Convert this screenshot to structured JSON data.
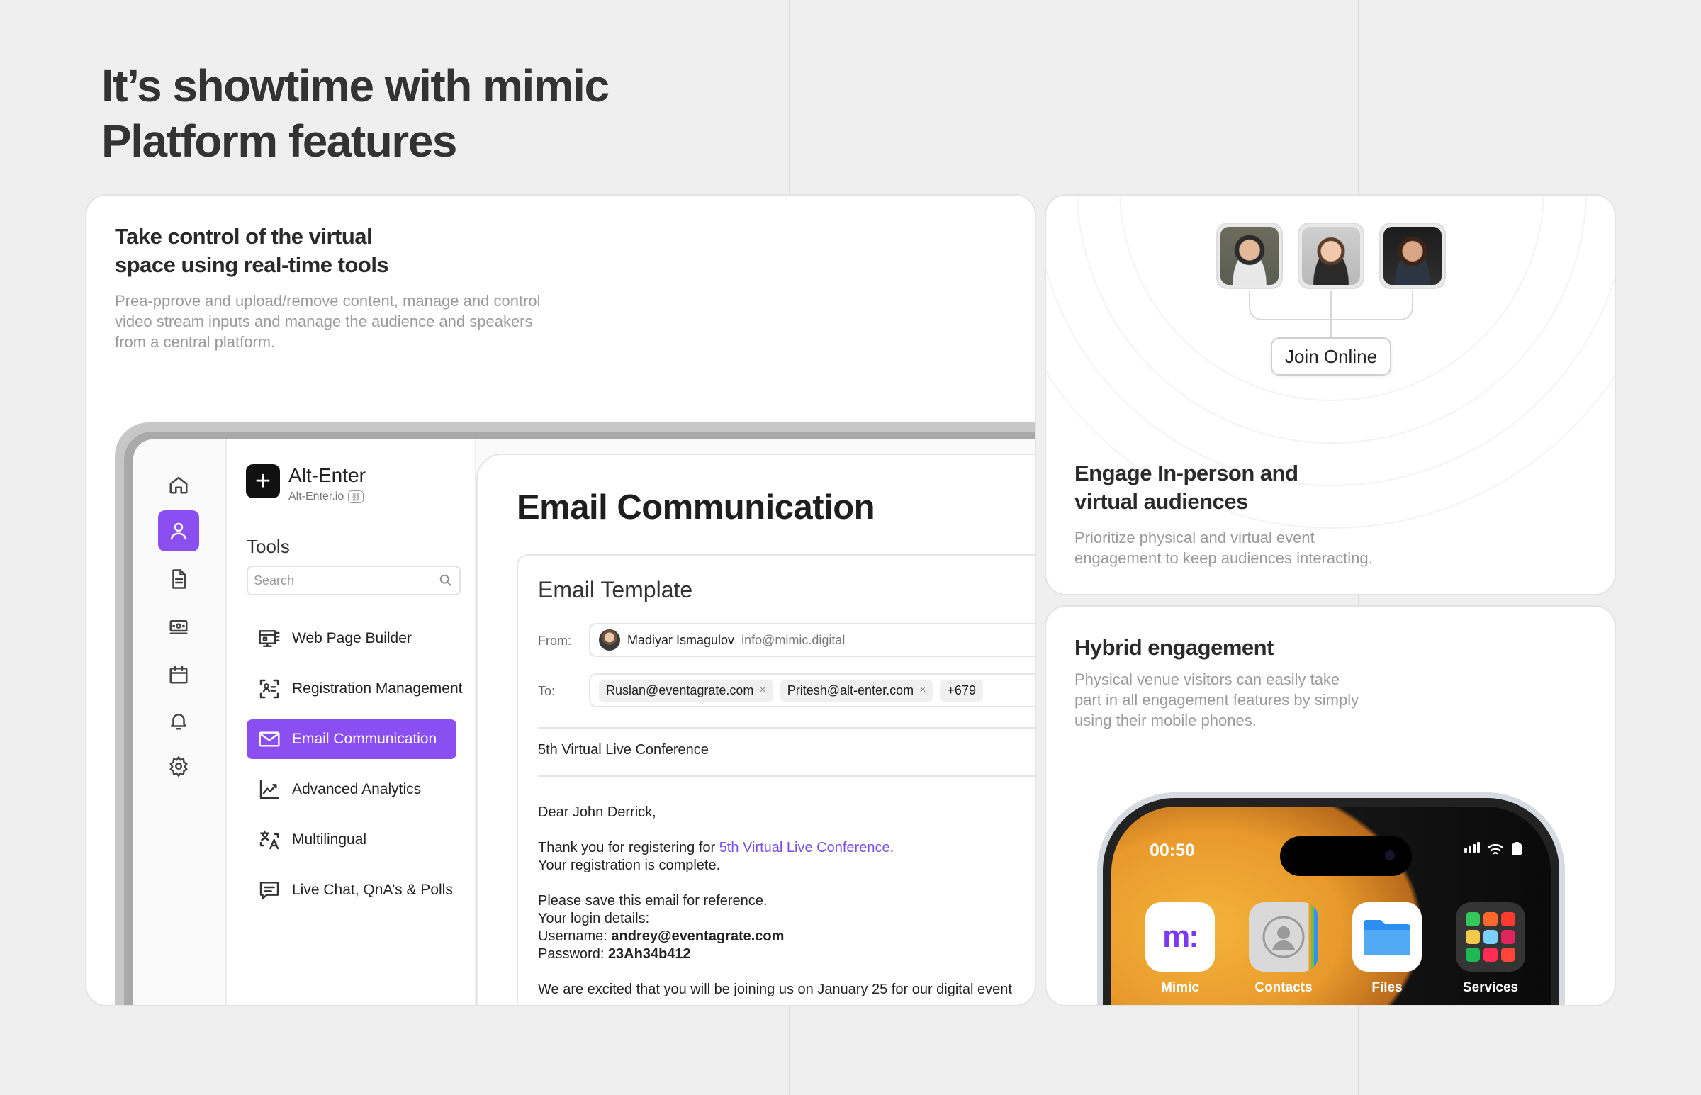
{
  "hero": {
    "line1": "It’s showtime with mimic",
    "line2": "Platform features"
  },
  "control_card": {
    "title_line1": "Take control of the virtual",
    "title_line2": "space using real-time tools",
    "desc_line1": "Prea-pprove and upload/remove content, manage and control",
    "desc_line2": "video stream inputs and manage the audience and speakers",
    "desc_line3": "from a central platform."
  },
  "app": {
    "rail_icons": [
      "home-icon",
      "user-icon",
      "document-icon",
      "ticket-icon",
      "calendar-icon",
      "bell-icon",
      "gear-icon"
    ],
    "org": {
      "logo_glyph": "+",
      "name": "Alt-Enter",
      "domain": "Alt-Enter.io"
    },
    "tools_label": "Tools",
    "search_placeholder": "Search",
    "tools": [
      {
        "label": "Web Page Builder",
        "icon": "web-builder-icon"
      },
      {
        "label": "Registration Management",
        "icon": "registration-icon"
      },
      {
        "label": "Email Communication",
        "icon": "envelope-icon",
        "active": true
      },
      {
        "label": "Advanced Analytics",
        "icon": "analytics-icon"
      },
      {
        "label": "Multilingual",
        "icon": "translate-icon"
      },
      {
        "label": "Live Chat, QnA’s & Polls",
        "icon": "chat-icon"
      }
    ],
    "main_title": "Email Communication",
    "template": {
      "title": "Email Template",
      "from_label": "From:",
      "from_name": "Madiyar Ismagulov",
      "from_email": "info@mimic.digital",
      "to_label": "To:",
      "recipients": [
        "Ruslan@eventagrate.com",
        "Pritesh@alt-enter.com"
      ],
      "more_count": "+679",
      "subject": "5th Virtual Live Conference",
      "greeting": "Dear John Derrick,",
      "thanks_prefix": "Thank you for registering for ",
      "thanks_link": "5th Virtual Live Conference.",
      "complete": "Your registration is complete.",
      "save_note": "Please save this email for reference.",
      "login_details": "Your login details:",
      "username_label": "Username: ",
      "username_value": "andrey@eventagrate.com",
      "password_label": "Password: ",
      "password_value": "23Ah34b412",
      "closing": "We are excited that you will be joining us on January 25 for our digital event"
    }
  },
  "engage_card": {
    "join_label": "Join Online",
    "title_line1": "Engage In-person and",
    "title_line2": "virtual audiences",
    "desc_line1": "Prioritize physical and virtual event",
    "desc_line2": "engagement to keep audiences interacting."
  },
  "hybrid_card": {
    "title": "Hybrid engagement",
    "desc_line1": "Physical venue visitors can easily take",
    "desc_line2": "part in all engagement features by simply",
    "desc_line3": "using their mobile phones.",
    "phone": {
      "time": "00:50",
      "apps": [
        {
          "label": "Mimic",
          "icon": "mimic-logo-icon"
        },
        {
          "label": "Contacts",
          "icon": "contacts-icon"
        },
        {
          "label": "Files",
          "icon": "folder-icon"
        },
        {
          "label": "Services",
          "icon": "services-folder-icon"
        }
      ],
      "mimic_logo_text": "m:"
    }
  },
  "colors": {
    "accent": "#8b4ef0",
    "background": "#efefef",
    "link": "#7b4de0"
  }
}
